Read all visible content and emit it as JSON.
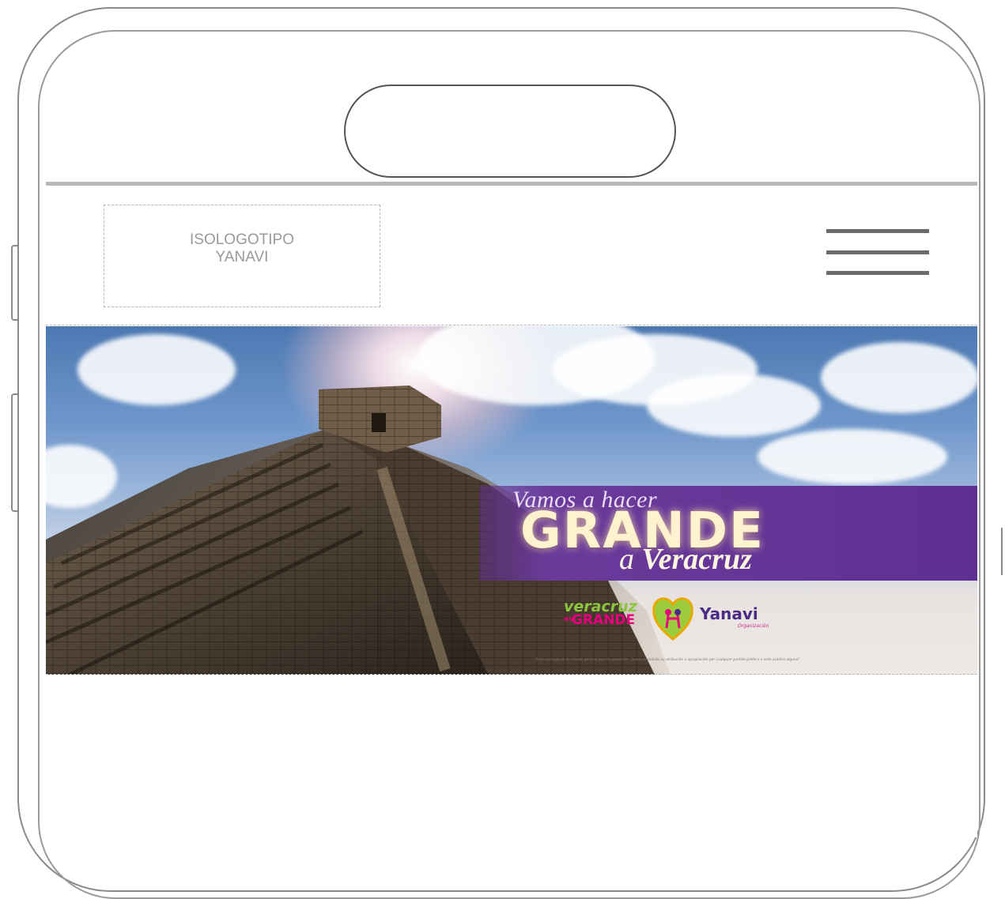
{
  "header": {
    "logo_placeholder": {
      "line1": "ISOLOGOTIPO",
      "line2": "YANAVI"
    }
  },
  "banner": {
    "tagline": {
      "line1": "Vamos a hacer",
      "line2": "GRANDE",
      "line3_prefix": "a ",
      "line3_bold": "Veracruz"
    },
    "logos": {
      "veracruz_line1": "veracruz",
      "veracruz_es": "es",
      "veracruz_line2": "GRANDE",
      "yanavi": "Yanavi",
      "yanavi_sub": "Organización"
    },
    "disclaimer": "\"Este mensaje es de interés general para la población. Queda prohibida su atribución o apropiación por cualquier partido político o ente público alguno\""
  },
  "colors": {
    "brand_purple": "#5f2f92",
    "veracruz_green": "#8cc63f",
    "veracruz_magenta": "#e6007e",
    "yanavi_purple": "#4b2a87"
  },
  "icons": {
    "menu": "hamburger-menu-icon"
  }
}
